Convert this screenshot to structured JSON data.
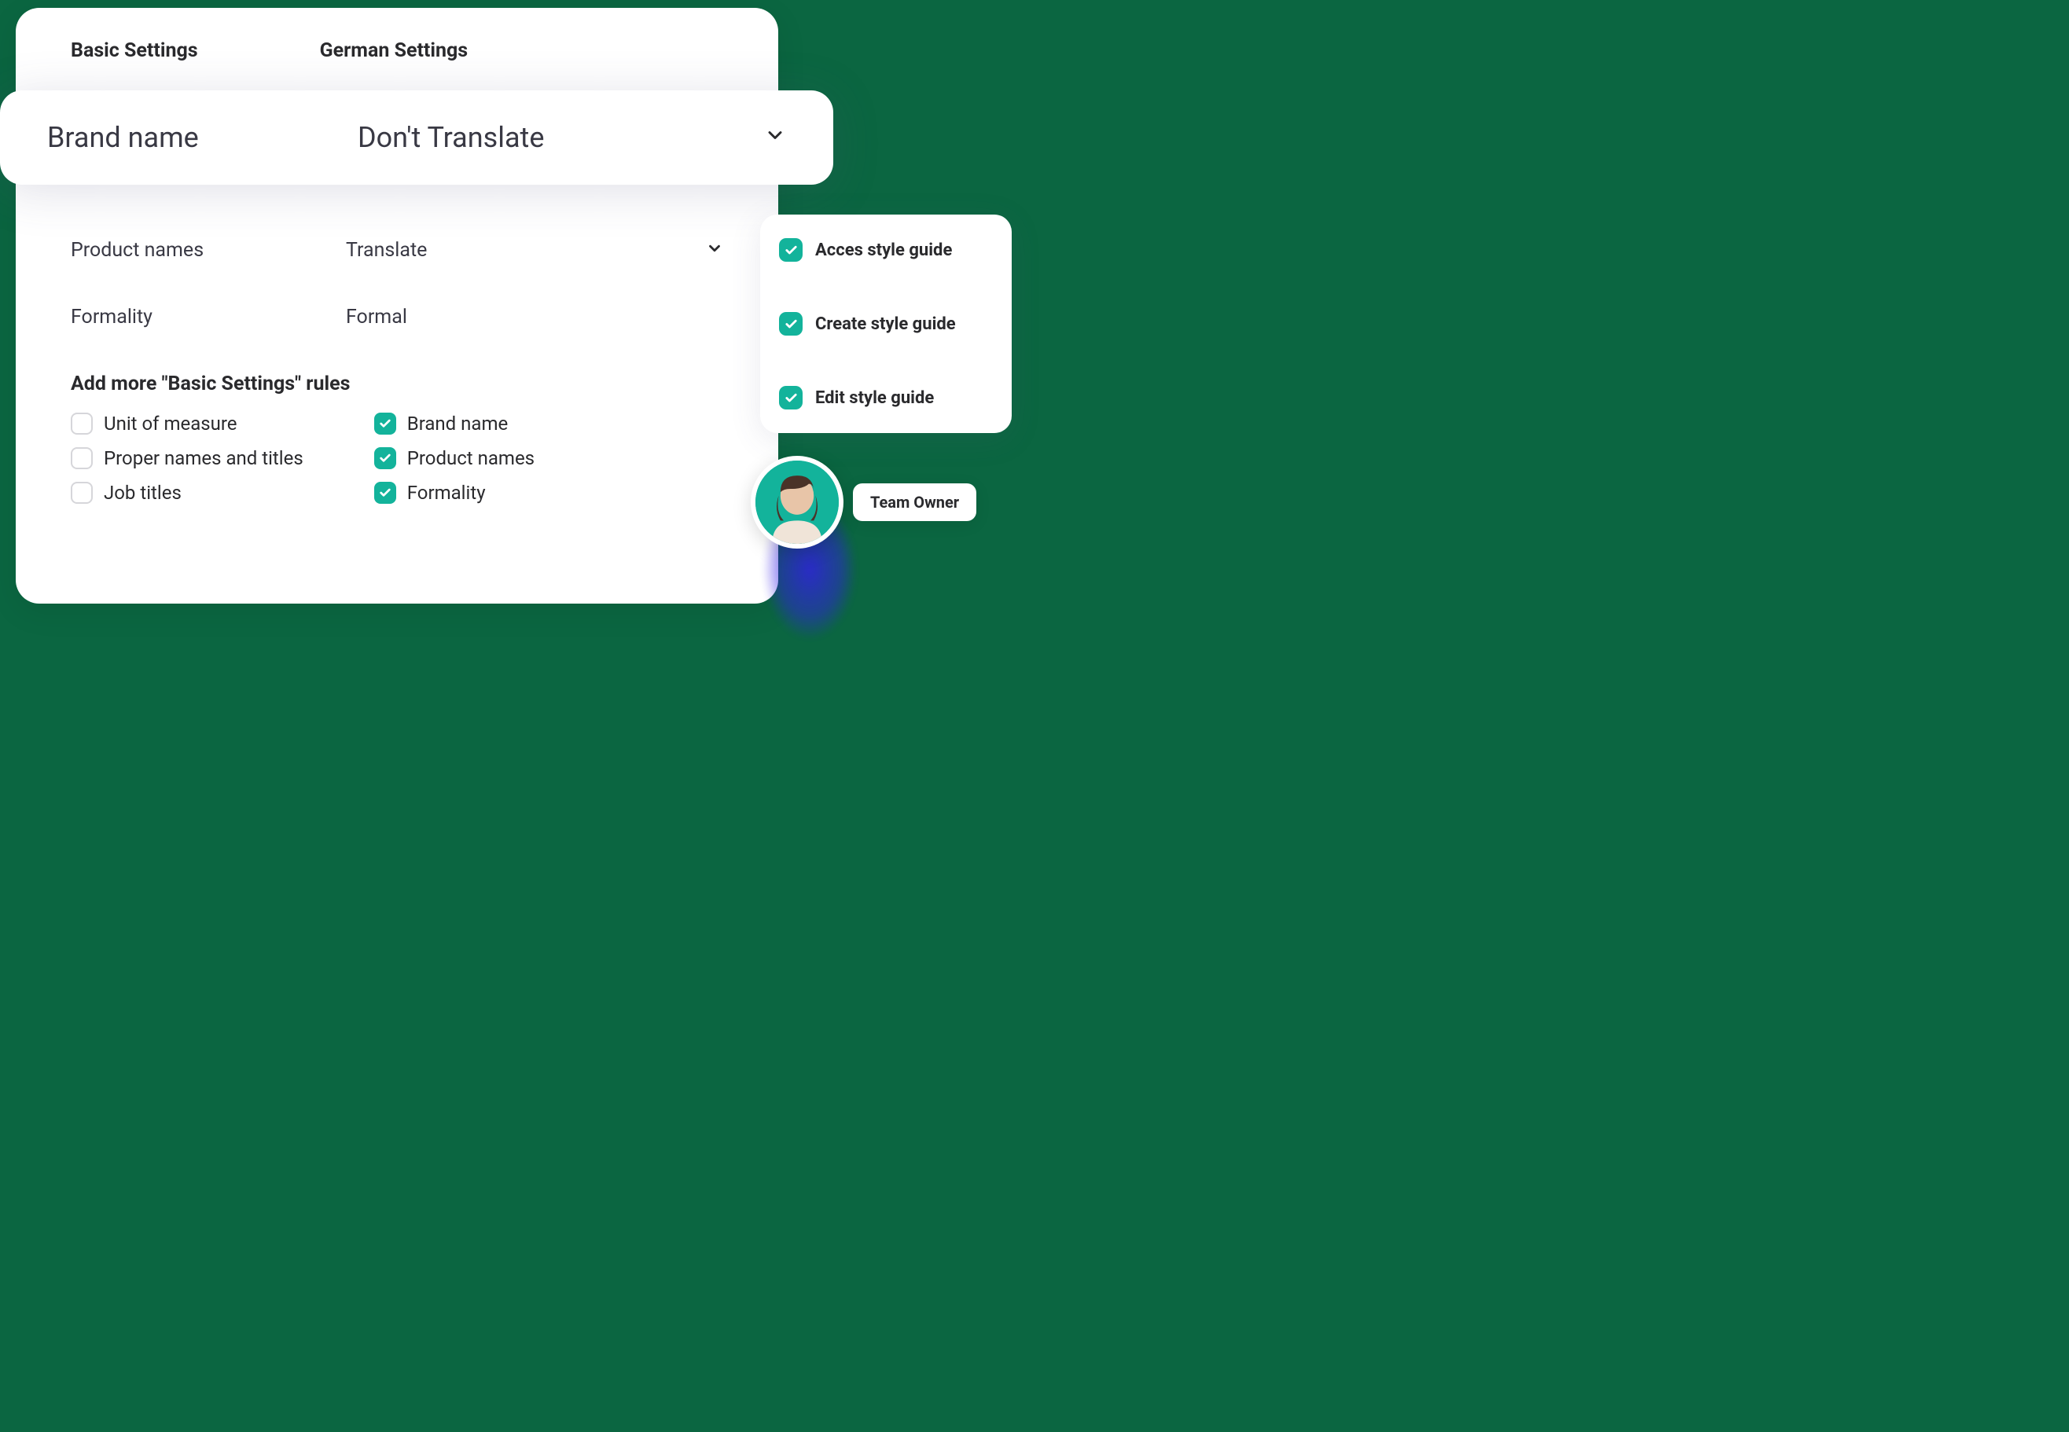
{
  "tabs": {
    "basic": "Basic Settings",
    "german": "German Settings"
  },
  "floating": {
    "label": "Brand name",
    "value": "Don't Translate"
  },
  "rows": {
    "product": {
      "label": "Product names",
      "value": "Translate"
    },
    "formality": {
      "label": "Formality",
      "value": "Formal"
    }
  },
  "section_heading": "Add more \"Basic Settings\" rules",
  "rules": {
    "col1": {
      "r1": "Unit of measure",
      "r2": "Proper names and titles",
      "r3": "Job titles"
    },
    "col2": {
      "r1": "Brand name",
      "r2": "Product names",
      "r3": "Formality"
    }
  },
  "permissions": {
    "p1": "Acces style guide",
    "p2": "Create style guide",
    "p3": "Edit style guide"
  },
  "role_badge": "Team Owner",
  "colors": {
    "accent": "#13b39b",
    "text": "#2a2a2d"
  }
}
